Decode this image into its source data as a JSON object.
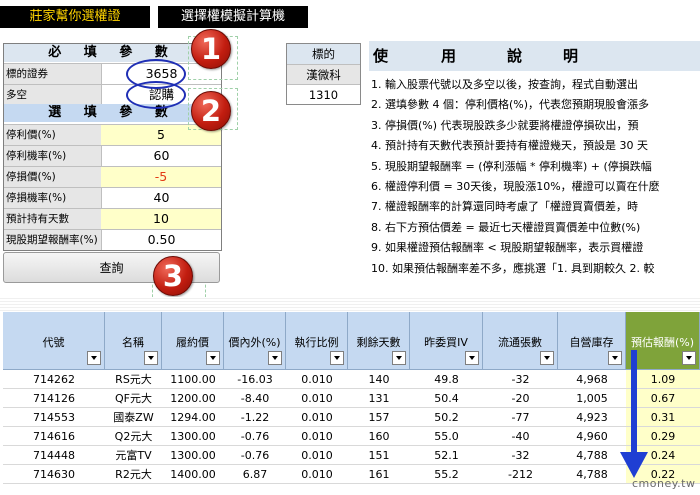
{
  "top_buttons": {
    "left": "莊家幫你選權證",
    "right": "選擇權模擬計算機"
  },
  "required": {
    "header": "必 填 參 數",
    "rows": [
      {
        "label": "標的證券",
        "value": "3658"
      },
      {
        "label": "多空",
        "value": "認購"
      }
    ]
  },
  "optional": {
    "header": "選 填 參 數",
    "rows": [
      {
        "label": "停利價(%)",
        "value": "5"
      },
      {
        "label": "停利機率(%)",
        "value": "60"
      },
      {
        "label": "停損價(%)",
        "value": "-5"
      },
      {
        "label": "停損機率(%)",
        "value": "40"
      },
      {
        "label": "預計持有天數",
        "value": "10"
      },
      {
        "label": "現股期望報酬率(%)",
        "value": "0.50"
      }
    ]
  },
  "query_button": "查詢",
  "underlying": {
    "header": "標的",
    "name": "漢微科",
    "code": "1310"
  },
  "instructions": {
    "title_chars": [
      "使",
      "用",
      "說",
      "明"
    ],
    "lines": [
      "1. 輸入股票代號以及多空以後，按查詢，程式自動選出",
      "2. 選填參數 4 個：停利價格(%)，代表您預期現股會漲多",
      "3. 停損價(%) 代表現股跌多少就要將權證停損砍出，預",
      "4. 預計持有天數代表預計要持有權證幾天，預設是 30 天",
      "5. 現股期望報酬率 = (停利漲幅 * 停利機率) + (停損跌幅",
      "6. 權證停利價 = 30天後，現股漲10%，權證可以賣在什麼",
      "7. 權證報酬率的計算還同時考慮了「權證買賣價差，時",
      "8. 右下方預估價差 = 最近七天權證買賣價差中位數(%)",
      "9. 如果權證預估報酬率 < 現股期望報酬率，表示買權證",
      "10. 如果預估報酬率差不多，應挑選「1. 具到期較久 2. 較"
    ]
  },
  "badges": [
    "1",
    "2",
    "3"
  ],
  "table": {
    "columns": [
      "代號",
      "名稱",
      "履約價",
      "價內外(%)",
      "執行比例",
      "剩餘天數",
      "昨委買IV",
      "流通張數",
      "自營庫存",
      "預估報酬(%)"
    ],
    "rows": [
      [
        "714262",
        "RS元大",
        "1100.00",
        "-16.03",
        "0.010",
        "140",
        "49.8",
        "-32",
        "4,968",
        "1.09"
      ],
      [
        "714126",
        "QF元大",
        "1200.00",
        "-8.40",
        "0.010",
        "131",
        "50.4",
        "-20",
        "1,005",
        "0.67"
      ],
      [
        "714553",
        "國泰ZW",
        "1294.00",
        "-1.22",
        "0.010",
        "157",
        "50.2",
        "-77",
        "4,923",
        "0.31"
      ],
      [
        "714616",
        "Q2元大",
        "1300.00",
        "-0.76",
        "0.010",
        "160",
        "55.0",
        "-40",
        "4,960",
        "0.29"
      ],
      [
        "714448",
        "元富TV",
        "1300.00",
        "-0.76",
        "0.010",
        "151",
        "52.1",
        "-32",
        "4,788",
        "0.24"
      ],
      [
        "714630",
        "R2元大",
        "1400.00",
        "6.87",
        "0.010",
        "161",
        "55.2",
        "-212",
        "4,788",
        "0.22"
      ]
    ]
  },
  "watermark": "cmoney.tw",
  "colors": {
    "header_blue": "#c5d9f1",
    "highlight_green": "#7fa33a",
    "input_yellow": "#ffffc9",
    "annotation_blue": "#1f2fb5",
    "badge_red": "#c21d10"
  }
}
